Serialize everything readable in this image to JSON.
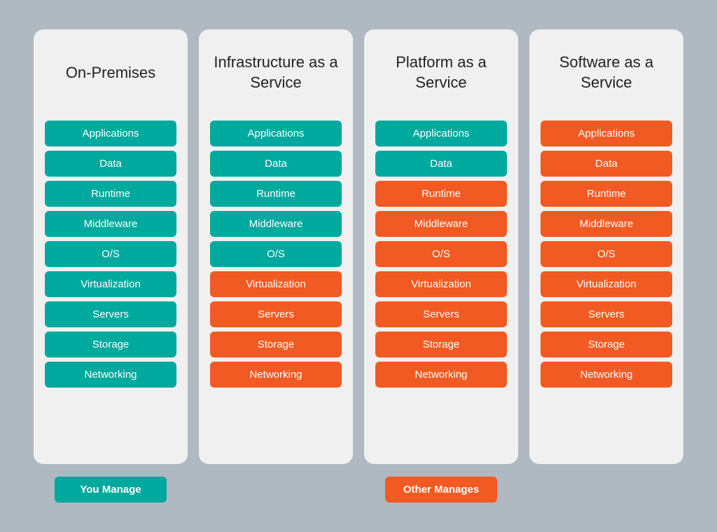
{
  "columns": [
    {
      "id": "on-premises",
      "title": "On-Premises",
      "items": [
        {
          "label": "Applications",
          "color": "teal"
        },
        {
          "label": "Data",
          "color": "teal"
        },
        {
          "label": "Runtime",
          "color": "teal"
        },
        {
          "label": "Middleware",
          "color": "teal"
        },
        {
          "label": "O/S",
          "color": "teal"
        },
        {
          "label": "Virtualization",
          "color": "teal"
        },
        {
          "label": "Servers",
          "color": "teal"
        },
        {
          "label": "Storage",
          "color": "teal"
        },
        {
          "label": "Networking",
          "color": "teal"
        }
      ]
    },
    {
      "id": "iaas",
      "title": "Infrastructure as a Service",
      "items": [
        {
          "label": "Applications",
          "color": "teal"
        },
        {
          "label": "Data",
          "color": "teal"
        },
        {
          "label": "Runtime",
          "color": "teal"
        },
        {
          "label": "Middleware",
          "color": "teal"
        },
        {
          "label": "O/S",
          "color": "teal"
        },
        {
          "label": "Virtualization",
          "color": "orange"
        },
        {
          "label": "Servers",
          "color": "orange"
        },
        {
          "label": "Storage",
          "color": "orange"
        },
        {
          "label": "Networking",
          "color": "orange"
        }
      ]
    },
    {
      "id": "paas",
      "title": "Platform as a Service",
      "items": [
        {
          "label": "Applications",
          "color": "teal"
        },
        {
          "label": "Data",
          "color": "teal"
        },
        {
          "label": "Runtime",
          "color": "orange"
        },
        {
          "label": "Middleware",
          "color": "orange"
        },
        {
          "label": "O/S",
          "color": "orange"
        },
        {
          "label": "Virtualization",
          "color": "orange"
        },
        {
          "label": "Servers",
          "color": "orange"
        },
        {
          "label": "Storage",
          "color": "orange"
        },
        {
          "label": "Networking",
          "color": "orange"
        }
      ]
    },
    {
      "id": "saas",
      "title": "Software as a Service",
      "items": [
        {
          "label": "Applications",
          "color": "orange"
        },
        {
          "label": "Data",
          "color": "orange"
        },
        {
          "label": "Runtime",
          "color": "orange"
        },
        {
          "label": "Middleware",
          "color": "orange"
        },
        {
          "label": "O/S",
          "color": "orange"
        },
        {
          "label": "Virtualization",
          "color": "orange"
        },
        {
          "label": "Servers",
          "color": "orange"
        },
        {
          "label": "Storage",
          "color": "orange"
        },
        {
          "label": "Networking",
          "color": "orange"
        }
      ]
    }
  ],
  "footer": {
    "you_manage": "You Manage",
    "other_manages": "Other Manages",
    "you_manage_color": "#00a99d",
    "other_manages_color": "#f15a22"
  }
}
